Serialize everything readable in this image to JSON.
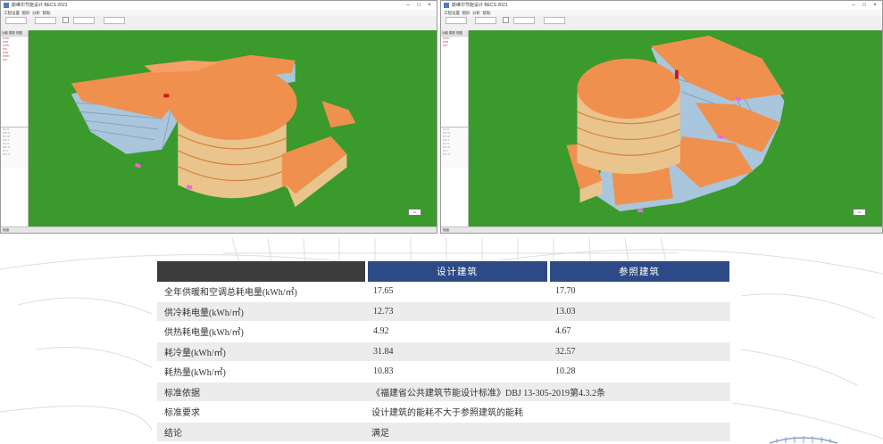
{
  "windows": [
    {
      "id": "left",
      "title_text": "斯维尔节能设计 BECS 2021",
      "menu": [
        "工程设置",
        "图形",
        "分析",
        "帮助"
      ],
      "sidebar_tabs": [
        "功能",
        "模型",
        "视图"
      ],
      "statusbar": "就绪"
    },
    {
      "id": "right",
      "title_text": "斯维尔节能设计 BECS 2021",
      "menu": [
        "工程设置",
        "图形",
        "分析",
        "帮助"
      ],
      "sidebar_tabs": [
        "功能",
        "模型",
        "视图"
      ],
      "statusbar": "就绪"
    }
  ],
  "colors": {
    "viewport_green": "#3a9a2c",
    "roof_orange": "#f0904e",
    "wall_tan": "#e9c48c",
    "window_blue": "#a9c6dd",
    "table_header_blue": "#2e4a86",
    "table_header_dark": "#3c3c3c"
  },
  "table": {
    "headers": [
      "",
      "设计建筑",
      "参照建筑"
    ],
    "rows": [
      {
        "label": "全年供暖和空调总耗电量(kWh/㎡)",
        "design": "17.65",
        "reference": "17.70"
      },
      {
        "label": "供冷耗电量(kWh/㎡)",
        "design": "12.73",
        "reference": "13.03"
      },
      {
        "label": "供热耗电量(kWh/㎡)",
        "design": "4.92",
        "reference": "4.67"
      },
      {
        "label": "耗冷量(kWh/㎡)",
        "design": "31.84",
        "reference": "32.57"
      },
      {
        "label": "耗热量(kWh/㎡)",
        "design": "10.83",
        "reference": "10.28"
      }
    ],
    "standard_basis_label": "标准依据",
    "standard_basis_value": "《福建省公共建筑节能设计标准》DBJ 13-305-2019第4.3.2条",
    "standard_requirement_label": "标准要求",
    "standard_requirement_value": "设计建筑的能耗不大于参照建筑的能耗",
    "conclusion_label": "结论",
    "conclusion_value": "满足"
  }
}
